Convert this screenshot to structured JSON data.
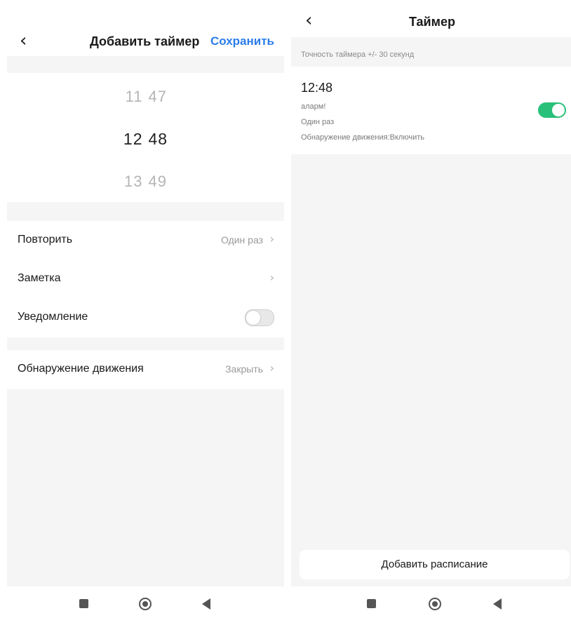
{
  "left": {
    "title": "Добавить таймер",
    "save_label": "Сохранить",
    "picker": {
      "prev": {
        "hour": "11",
        "minute": "47"
      },
      "current": {
        "hour": "12",
        "minute": "48"
      },
      "next": {
        "hour": "13",
        "minute": "49"
      }
    },
    "repeat": {
      "label": "Повторить",
      "value": "Один раз"
    },
    "note": {
      "label": "Заметка"
    },
    "notification": {
      "label": "Уведомление",
      "enabled": false
    },
    "motion": {
      "label": "Обнаружение движения",
      "value": "Закрыть"
    }
  },
  "right": {
    "title": "Таймер",
    "hint": "Точность таймера +/- 30 секунд",
    "timer": {
      "time": "12:48",
      "note": "аларм!",
      "repeat": "Один раз",
      "motion": "Обнаружение движения:Включить",
      "enabled": true
    },
    "add_button": "Добавить расписание"
  },
  "colors": {
    "accent": "#2b7de9",
    "toggle_on": "#29c17a",
    "section_gray": "#f5f5f5"
  },
  "icons": {
    "back": "chevron-left-icon",
    "chevron": "chevron-right-icon",
    "nav_recent": "square-icon",
    "nav_home": "circle-icon",
    "nav_back": "triangle-back-icon"
  }
}
